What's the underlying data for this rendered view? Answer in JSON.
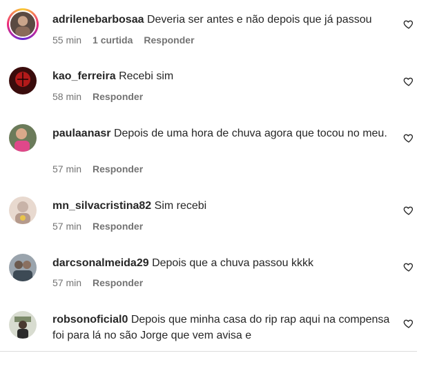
{
  "comments": [
    {
      "username": "adrilenebarbosaa",
      "text": "Deveria ser antes e não depois que já passou",
      "time": "55 min",
      "likes": "1 curtida",
      "reply": "Responder",
      "avatar_colors": [
        "#5a4a42",
        "#c9a48a"
      ]
    },
    {
      "username": "kao_ferreira",
      "text": "Recebi sim",
      "time": "58 min",
      "reply": "Responder",
      "avatar_colors": [
        "#3a0c0c",
        "#b21a1a"
      ]
    },
    {
      "username": "paulaanasr",
      "text": "Depois de uma hora de chuva agora que tocou no meu.",
      "time": "57 min",
      "reply": "Responder",
      "avatar_colors": [
        "#6b7b5a",
        "#e0488a"
      ]
    },
    {
      "username": "mn_silvacristina82",
      "text": "Sim recebi",
      "time": "57 min",
      "reply": "Responder",
      "avatar_colors": [
        "#c8b3a8",
        "#e8d9cf"
      ]
    },
    {
      "username": "darcsonalmeida29",
      "text": "Depois que a chuva passou kkkk",
      "time": "57 min",
      "reply": "Responder",
      "avatar_colors": [
        "#3d4a55",
        "#9aa4ad"
      ]
    },
    {
      "username": "robsonoficial0",
      "text": "Depois que minha casa do rip rap aqui na compensa foi para lá no são Jorge que vem avisa e",
      "reply": "Responder",
      "avatar_colors": [
        "#7c8a6a",
        "#d8dcd0"
      ]
    }
  ],
  "icons": {
    "like": "heart-outline-icon"
  },
  "colors": {
    "text": "#262626",
    "meta": "#737373",
    "divider": "#dbdbdb"
  }
}
